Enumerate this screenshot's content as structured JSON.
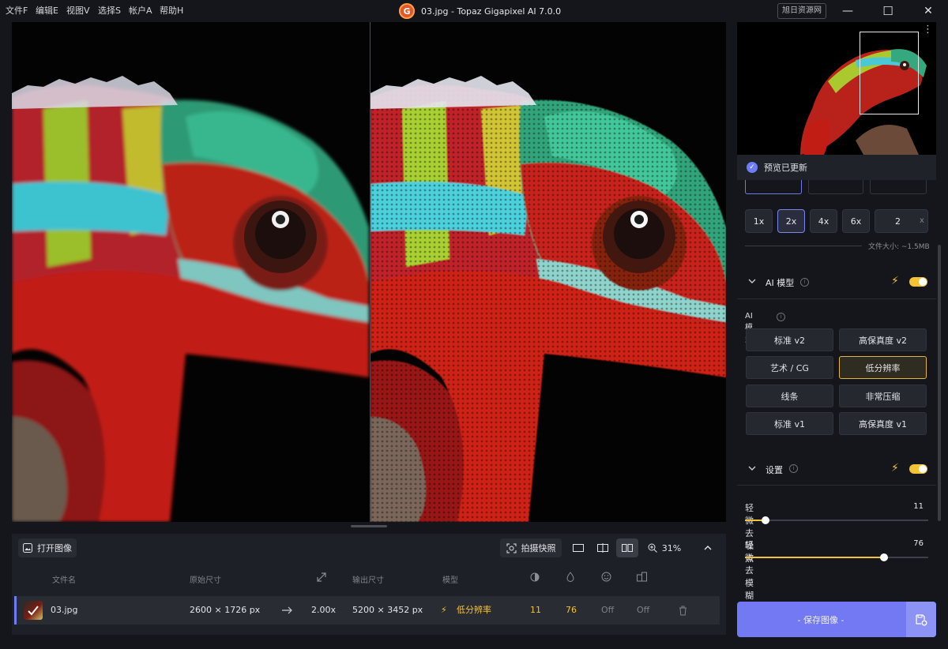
{
  "menu": [
    "文件F",
    "编辑E",
    "视图V",
    "选择S",
    "帐户A",
    "帮助H"
  ],
  "window": {
    "logo_letter": "G",
    "title": "03.jpg - Topaz Gigapixel AI 7.0.0",
    "watermark": "旭日资源网",
    "minimize": "—",
    "maximize": "☐",
    "close": "✕"
  },
  "toolbar": {
    "open_label": "打开图像",
    "snapshot_label": "拍摄快照",
    "zoom_label": "31%"
  },
  "table": {
    "headers": {
      "filename": "文件名",
      "original_size": "原始尺寸",
      "output_size": "输出尺寸",
      "model": "模型"
    },
    "row": {
      "filename": "03.jpg",
      "original_size": "2600 × 1726 px",
      "scale": "2.00x",
      "output_size": "5200 × 3452 px",
      "model": "低分辨率",
      "denoise": "11",
      "deblur": "76",
      "face": "Off",
      "compression": "Off"
    }
  },
  "right_panel": {
    "preview_status": "预览已更新",
    "scales": [
      "1x",
      "2x",
      "4x",
      "6x"
    ],
    "custom_scale": "2",
    "custom_scale_unit": "x",
    "file_size": "文件大小: ~1.5MB",
    "ai_section_title": "AI 模型",
    "ai_model_label": "AI 模型",
    "models": [
      "标准 v2",
      "高保真度 v2",
      "艺术 / CG",
      "低分辨率",
      "线条",
      "非常压缩",
      "标准 v1",
      "高保真度 v1"
    ],
    "selected_model": "低分辨率",
    "settings_title": "设置",
    "denoise_label": "轻微去噪点",
    "denoise_value": "11",
    "denoise_fraction": 0.11,
    "deblur_label": "轻微去模糊",
    "deblur_value": "76",
    "deblur_fraction": 0.76,
    "save_label": "- 保存图像 -"
  },
  "colors": {
    "accent": "#7279f3",
    "highlight": "#f3c333",
    "background": "#15161b",
    "panel": "#1e2027"
  }
}
